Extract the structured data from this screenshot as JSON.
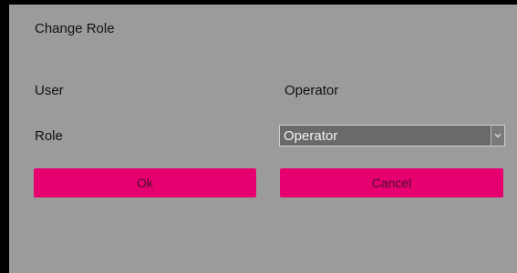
{
  "dialog": {
    "title": "Change Role",
    "fields": {
      "user_label": "User",
      "user_value": "Operator",
      "role_label": "Role",
      "role_selected": "Operator"
    },
    "buttons": {
      "ok_label": "Ok",
      "cancel_label": "Cancel"
    },
    "icons": {
      "select_arrow": "chevron-down-icon"
    },
    "colors": {
      "dialog_background": "#9b9b9b",
      "button_accent": "#e6006f",
      "select_background": "#6a6a6a"
    }
  }
}
